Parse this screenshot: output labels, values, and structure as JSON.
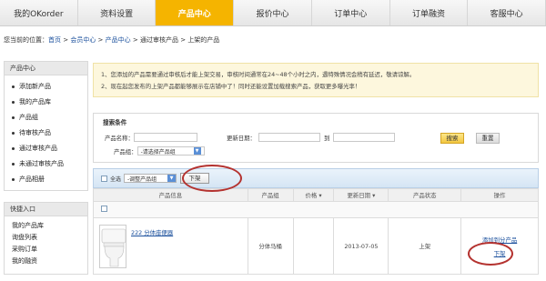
{
  "nav": {
    "tabs": [
      "我的OKorder",
      "资料设置",
      "产品中心",
      "报价中心",
      "订单中心",
      "订单融资",
      "客服中心"
    ],
    "active_index": 2
  },
  "breadcrumb": {
    "prefix": "您当前的位置：",
    "items": [
      "首页",
      "会员中心",
      "产品中心",
      "通过审核产品",
      "上架的产品"
    ],
    "separator": " > "
  },
  "sidebar": {
    "product_center_title": "产品中心",
    "items": [
      "添加新产品",
      "我的产品库",
      "产品组",
      "待审核产品",
      "通过审核产品",
      "未通过审核产品",
      "产品相册"
    ],
    "quick_title": "快捷入口",
    "quick_items": [
      "我的产品库",
      "询盘列表",
      "采购订单",
      "我的融资"
    ]
  },
  "notice": {
    "line1": "1、您添加的产品需要通过审核后才能上架交易，审核时间通常在24~48个小时之内，遇特殊情况会稍有延迟，敬请谅解。",
    "line2": "2、现在起您发布的上架产品都能够展示在店铺中了！同时还能设置加载搜索产品，获取更多曝光率！"
  },
  "search": {
    "title": "搜索条件",
    "name_label": "产品名称：",
    "name_value": "",
    "date_label": "更新日期：",
    "date_from": "",
    "date_to_label": "到",
    "date_to": "",
    "group_label": "产品组：",
    "group_selected": "-请选择产品组",
    "search_btn": "搜索",
    "reset_btn": "重置"
  },
  "actions": {
    "select_all": "全选",
    "adjust_group": "-调整产品组",
    "delist_btn": "下架"
  },
  "table": {
    "headers": [
      "产品信息",
      "产品组",
      "价格",
      "更新日期",
      "产品状态",
      "操作"
    ],
    "rows": [
      {
        "name": "222 分体座便器",
        "group": "分体马桶",
        "price": "",
        "date": "2013-07-05",
        "status": "上架",
        "op_add": "添加到分产品",
        "op_delist": "下架"
      }
    ]
  },
  "colors": {
    "active_tab": "#f5b400",
    "link": "#1a4f9c",
    "annotation_circle": "#b4322f"
  }
}
